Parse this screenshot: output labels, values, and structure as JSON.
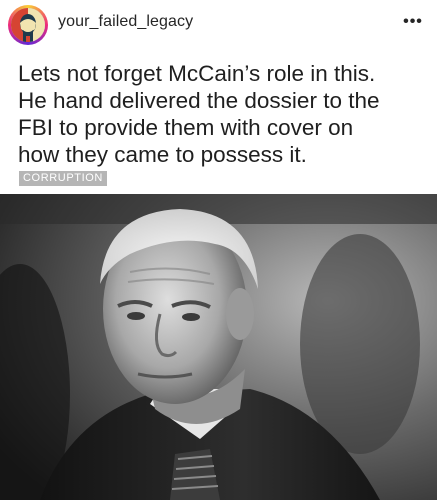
{
  "post": {
    "username": "your_failed_legacy",
    "more_icon": "ellipsis-icon",
    "quote_lines": [
      "Lets not forget McCain’s role in this.",
      "He hand delivered the dossier to the",
      "FBI to provide them with cover on",
      "how they came to possess it."
    ],
    "tag": "CORRUPTION",
    "more_text": "•••"
  },
  "colors": {
    "text": "#1f1f1f",
    "tag_bg": "#b5b5b5",
    "ring_start": "#f9ce34",
    "ring_mid": "#ee2a7b",
    "ring_end": "#6228d7"
  }
}
